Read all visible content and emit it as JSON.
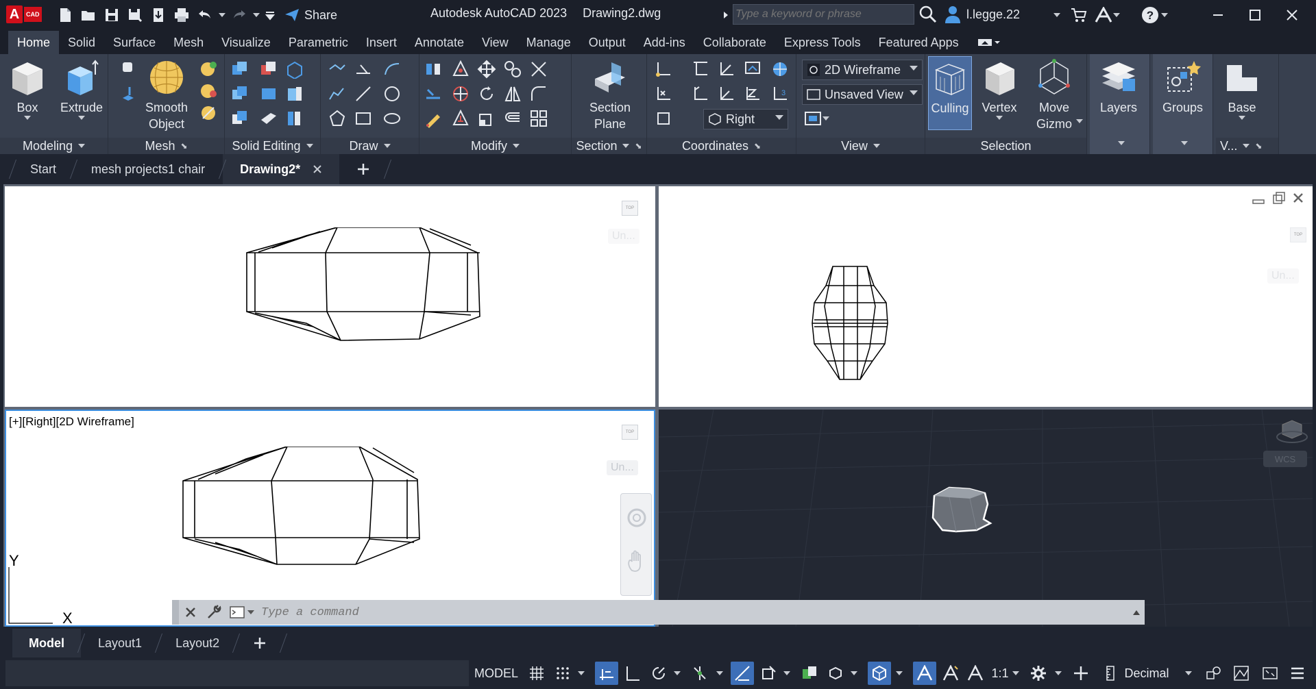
{
  "titlebar": {
    "logo_letter": "A",
    "logo_tag": "CAD",
    "share_label": "Share",
    "app_title": "Autodesk AutoCAD 2023",
    "document": "Drawing2.dwg",
    "search_placeholder": "Type a keyword or phrase",
    "username": "l.legge.22"
  },
  "ribbon_tabs": [
    "Home",
    "Solid",
    "Surface",
    "Mesh",
    "Visualize",
    "Parametric",
    "Insert",
    "Annotate",
    "View",
    "Manage",
    "Output",
    "Add-ins",
    "Collaborate",
    "Express Tools",
    "Featured Apps"
  ],
  "ribbon": {
    "modeling": {
      "title": "Modeling",
      "box": "Box",
      "extrude": "Extrude"
    },
    "mesh": {
      "title": "Mesh",
      "smooth_line1": "Smooth",
      "smooth_line2": "Object"
    },
    "solid_editing": {
      "title": "Solid Editing"
    },
    "draw": {
      "title": "Draw"
    },
    "modify": {
      "title": "Modify"
    },
    "section": {
      "title": "Section",
      "plane_line1": "Section",
      "plane_line2": "Plane"
    },
    "coordinates": {
      "title": "Coordinates",
      "ucs_view": "Right"
    },
    "view": {
      "title": "View",
      "visual_style": "2D Wireframe",
      "named_view": "Unsaved View"
    },
    "selection": {
      "title": "Selection",
      "culling": "Culling",
      "vertex": "Vertex",
      "gizmo_line1": "Move",
      "gizmo_line2": "Gizmo"
    },
    "layers": {
      "label": "Layers"
    },
    "groups": {
      "label": "Groups"
    },
    "base": {
      "label": "Base",
      "panel_title": "V..."
    }
  },
  "doc_tabs": [
    {
      "label": "Start"
    },
    {
      "label": "mesh projects1 chair"
    },
    {
      "label": "Drawing2*"
    }
  ],
  "viewports": {
    "bottom_left_label": "[+][Right][2D Wireframe]",
    "unnamed_label": "Un...",
    "axis_y": "Y",
    "axis_x": "X"
  },
  "command": {
    "placeholder": "Type a command"
  },
  "layout_tabs": [
    "Model",
    "Layout1",
    "Layout2"
  ],
  "status": {
    "model": "MODEL",
    "scale": "1:1",
    "units": "Decimal"
  },
  "colors": {
    "accent": "#3d6fb8",
    "ribbon_bg": "#38404f",
    "title_bg": "#1b1f29"
  }
}
